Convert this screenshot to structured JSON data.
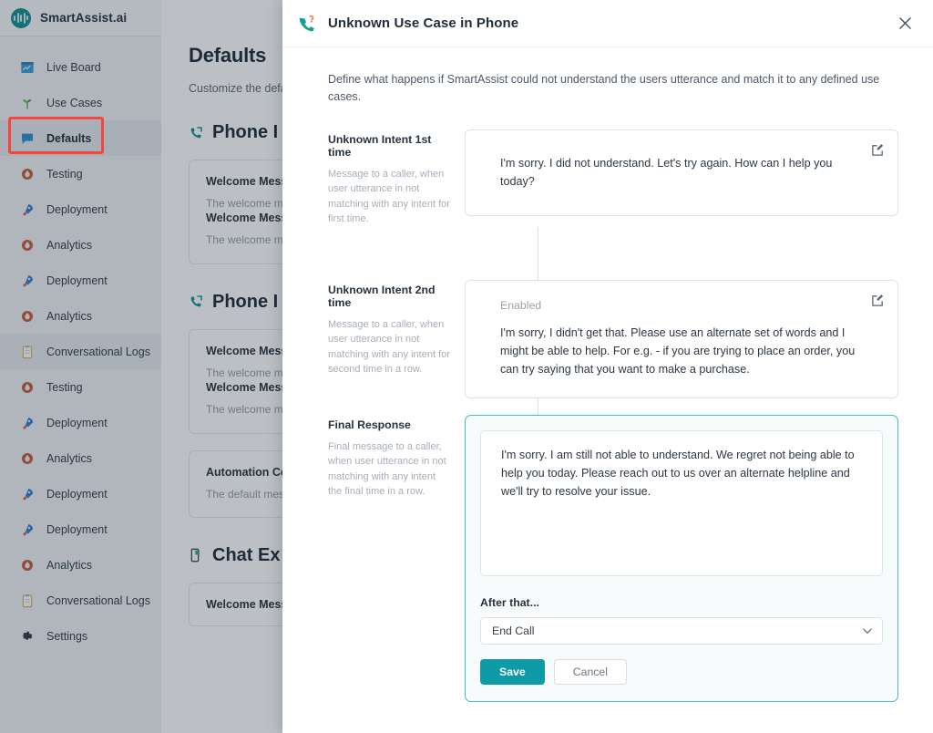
{
  "brand": {
    "name": "SmartAssist.ai",
    "logo_icon": "audio-wave-logo-icon",
    "color": "#0f8d94"
  },
  "sidebar": {
    "items": [
      {
        "label": "Live Board",
        "icon": "live-board-icon",
        "state": "default"
      },
      {
        "label": "Use Cases",
        "icon": "sprout-icon",
        "state": "default"
      },
      {
        "label": "Defaults",
        "icon": "chat-bubble-icon",
        "state": "active"
      },
      {
        "label": "Testing",
        "icon": "droplet-icon",
        "state": "default"
      },
      {
        "label": "Deployment",
        "icon": "rocket-icon",
        "state": "default"
      },
      {
        "label": "Analytics",
        "icon": "droplet-icon",
        "state": "default"
      },
      {
        "label": "Deployment",
        "icon": "rocket-icon",
        "state": "default"
      },
      {
        "label": "Analytics",
        "icon": "droplet-icon",
        "state": "default"
      },
      {
        "label": "Conversational Logs",
        "icon": "clipboard-icon",
        "state": "hovered"
      },
      {
        "label": "Testing",
        "icon": "droplet-icon",
        "state": "default"
      },
      {
        "label": "Deployment",
        "icon": "rocket-icon",
        "state": "default"
      },
      {
        "label": "Analytics",
        "icon": "droplet-icon",
        "state": "default"
      },
      {
        "label": "Deployment",
        "icon": "rocket-icon",
        "state": "default"
      },
      {
        "label": "Deployment",
        "icon": "rocket-icon",
        "state": "default"
      },
      {
        "label": "Analytics",
        "icon": "droplet-icon",
        "state": "default"
      },
      {
        "label": "Conversational Logs",
        "icon": "clipboard-icon",
        "state": "default"
      },
      {
        "label": "Settings",
        "icon": "gear-icon",
        "state": "default"
      }
    ]
  },
  "background_page": {
    "title": "Defaults",
    "subtitle": "Customize the defa",
    "sections": [
      {
        "heading": "Phone I",
        "icon": "phone-icon",
        "cards": [
          {
            "items": [
              {
                "title": "Welcome Messa",
                "desc": "The welcome mess hears when they fi support"
              },
              {
                "title": "Welcome Messa",
                "desc": "The welcome mess hears when they fi support."
              }
            ]
          }
        ]
      },
      {
        "heading": "Phone I",
        "icon": "phone-icon",
        "cards": [
          {
            "items": [
              {
                "title": "Welcome Messa",
                "desc": "The welcome mess hears when they fi support"
              },
              {
                "title": "Welcome Messa",
                "desc": "The welcome mess"
              }
            ]
          },
          {
            "items": [
              {
                "title": "Automation Con",
                "desc": "The default messa after the completio automation flow fo"
              }
            ]
          }
        ]
      },
      {
        "heading": "Chat Ex",
        "icon": "chat-device-icon",
        "cards": [
          {
            "items": [
              {
                "title": "Welcome Messa",
                "desc": ""
              }
            ]
          }
        ]
      }
    ]
  },
  "modal": {
    "icon": "phone-question-icon",
    "title": "Unknown Use Case in Phone",
    "close_icon": "close-icon",
    "intro": "Define what happens if SmartAssist could not understand the users utterance and match it to any defined use cases.",
    "rows": [
      {
        "title": "Unknown Intent 1st time",
        "desc": "Message to a caller, when user utterance in not matching with any intent for first time.",
        "status_label": "",
        "message": "I'm sorry. I did not understand. Let's try again. How can I help you today?",
        "edit_icon": "edit-icon"
      },
      {
        "title": "Unknown Intent 2nd time",
        "desc": "Message to a caller, when user utterance in not matching with any intent for second time in a row.",
        "status_label": "Enabled",
        "message": "I'm sorry, I didn't get that. Please use an alternate set of words and I might be able to help. For e.g. - if you are trying to place an order, you can try saying that you want to make a purchase.",
        "edit_icon": "edit-icon"
      }
    ],
    "final_response": {
      "title": "Final Response",
      "desc": "Final message to a caller, when user utterance in not matching with any intent the final time in a row.",
      "message": "I'm sorry. I am still not able to understand. We regret not being able to help you today. Please reach out to us over an alternate helpline and we'll try to resolve your issue.",
      "after_label": "After that...",
      "select_value": "End Call",
      "select_options": [
        "End Call"
      ],
      "select_arrow_icon": "chevron-down-icon",
      "save_label": "Save",
      "cancel_label": "Cancel",
      "accent_color": "#49b7c6",
      "save_color": "#0e9aa7"
    }
  },
  "annotation": {
    "color": "#f5453c",
    "target": "sidebar-item-defaults"
  }
}
